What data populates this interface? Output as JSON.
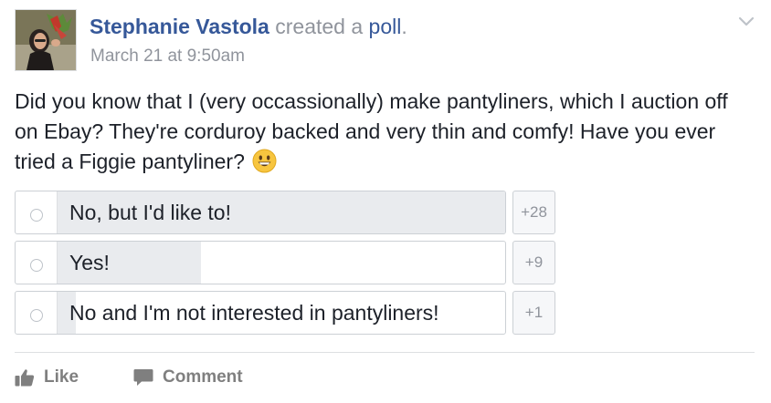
{
  "header": {
    "author": "Stephanie Vastola",
    "action": "created a",
    "object": "poll",
    "period": ".",
    "timestamp": "March 21 at 9:50am"
  },
  "post": {
    "text": "Did you know that I (very occassionally) make pantyliners, which I auction off on Ebay? They're corduroy backed and very thin and comfy! Have you ever tried a Figgie pantyliner?",
    "emoji": "grinning-face-icon"
  },
  "poll": {
    "options": [
      {
        "label": "No, but I'd like to!",
        "count": "+28",
        "share": 1.0
      },
      {
        "label": "Yes!",
        "count": "+9",
        "share": 0.32
      },
      {
        "label": "No and I'm not interested in pantyliners!",
        "count": "+1",
        "share": 0.04
      }
    ]
  },
  "actions": {
    "like_label": "Like",
    "comment_label": "Comment"
  },
  "colors": {
    "link": "#365899",
    "meta": "#90949c",
    "poll_fill": "#e9ebee",
    "border": "#ccd0d5"
  }
}
